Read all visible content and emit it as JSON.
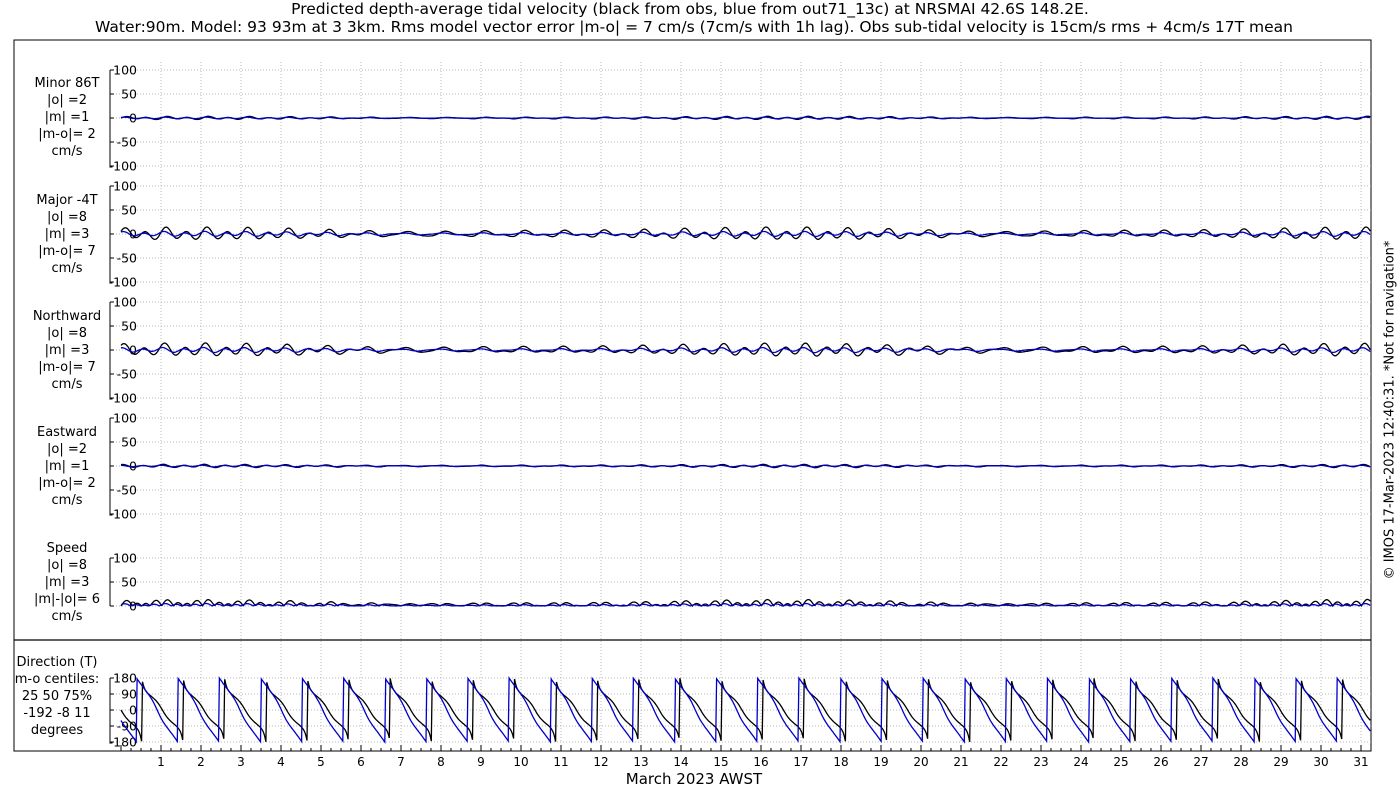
{
  "header": {
    "title": "Predicted depth-average tidal velocity (black from obs, blue from out71_13c) at NRSMAI 42.6S 148.2E.",
    "subtitle": "Water:90m. Model: 93 93m at 3 3km. Rms model vector error |m-o| = 7 cm/s (7cm/s with 1h lag). Obs sub-tidal velocity is 15cm/s rms + 4cm/s 17T mean"
  },
  "footer": {
    "xlabel": "March 2023 AWST",
    "copyright": "© IMOS 17-Mar-2023 12:40:31. *Not for navigation*"
  },
  "panels": [
    {
      "label": [
        "Minor 86T",
        "|o| =2",
        "|m| =1",
        "|m-o|= 2",
        "cm/s"
      ],
      "yticks": [
        "100",
        "50",
        "0",
        "-50",
        "-100"
      ]
    },
    {
      "label": [
        "Major -4T",
        "|o| =8",
        "|m| =3",
        "|m-o|= 7",
        "cm/s"
      ],
      "yticks": [
        "100",
        "50",
        "0",
        "-50",
        "-100"
      ]
    },
    {
      "label": [
        "Northward",
        "|o| =8",
        "|m| =3",
        "|m-o|= 7",
        "cm/s"
      ],
      "yticks": [
        "100",
        "50",
        "0",
        "-50",
        "-100"
      ]
    },
    {
      "label": [
        "Eastward",
        "|o| =2",
        "|m| =1",
        "|m-o|= 2",
        "cm/s"
      ],
      "yticks": [
        "100",
        "50",
        "0",
        "-50",
        "-100"
      ]
    },
    {
      "label": [
        "Speed",
        "|o| =8",
        "|m| =3",
        "|m|-|o|= 6",
        "cm/s"
      ],
      "yticks": [
        "100",
        "50",
        "0"
      ]
    },
    {
      "label": [
        "Direction (T)",
        "m-o centiles:",
        "25  50  75%",
        "-192   -8   11",
        "degrees"
      ],
      "yticks": [
        "180",
        "90",
        "0",
        "-90",
        "-180"
      ]
    }
  ],
  "chart_data": {
    "type": "line",
    "x_axis": {
      "label": "March 2023 AWST",
      "ticks": [
        "1",
        "2",
        "3",
        "4",
        "5",
        "6",
        "7",
        "8",
        "9",
        "10",
        "11",
        "12",
        "13",
        "14",
        "15",
        "16",
        "17",
        "18",
        "19",
        "20",
        "21",
        "22",
        "23",
        "24",
        "25",
        "26",
        "27",
        "28",
        "29",
        "30",
        "31"
      ],
      "xlim": [
        0,
        31.3
      ]
    },
    "series_colors": {
      "obs": "#000000",
      "model": "#0000cc"
    },
    "grid": true,
    "subplots": [
      {
        "name": "Minor 86T",
        "ylim": [
          -100,
          100
        ],
        "obs_amplitude": 2,
        "model_amplitude": 1
      },
      {
        "name": "Major -4T",
        "ylim": [
          -100,
          100
        ],
        "obs_amplitude": 8,
        "model_amplitude": 3
      },
      {
        "name": "Northward",
        "ylim": [
          -100,
          100
        ],
        "obs_amplitude": 8,
        "model_amplitude": 3
      },
      {
        "name": "Eastward",
        "ylim": [
          -100,
          100
        ],
        "obs_amplitude": 2,
        "model_amplitude": 1
      },
      {
        "name": "Speed",
        "ylim": [
          0,
          100
        ],
        "obs_amplitude": 8,
        "model_amplitude": 3
      },
      {
        "name": "Direction (T)",
        "ylim": [
          -180,
          180
        ]
      }
    ]
  }
}
